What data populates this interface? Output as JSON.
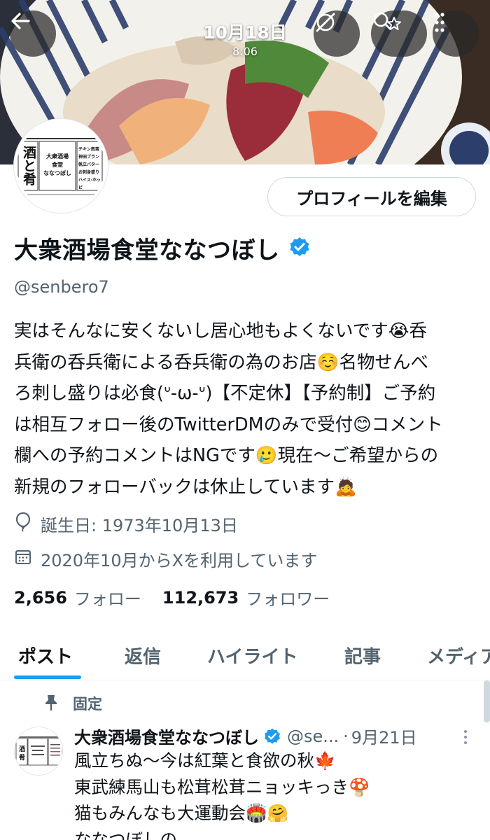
{
  "status": {
    "date": "10月18日",
    "time": "8:06"
  },
  "colors": {
    "accent": "#1d9bf0",
    "verified": "#1d9bf0",
    "text": "#0f1419",
    "muted": "#536471"
  },
  "icons": {
    "back": "arrow-left-icon",
    "grok": "slash-circle-icon",
    "search": "search-star-icon",
    "more": "vertical-dots-icon"
  },
  "avatar": {
    "left_text": "酒と肴",
    "center_text": "大衆酒場\n食堂\nななつぼし",
    "right_text": "チキン南蛮\n神田ブラン\n帆立バター\nお刺身盛り\nハイス·ホッピ"
  },
  "edit_button": "プロフィールを編集",
  "profile": {
    "name": "大衆酒場食堂ななつぼし",
    "handle": "@senbero7",
    "bio": "実はそんなに安くないし居心地もよくないです😭呑\n兵衛の呑兵衛による呑兵衛の為のお店☺️名物せんべ\nろ刺し盛りは必食(ᐡ-ω-ᐡ)【不定休】【予約制】ご予約\nは相互フォロー後のTwitterDMのみで受付😊コメント\n欄への予約コメントはNGです🥲現在〜ご希望からの\n新規のフォローバックは休止しています🙇",
    "birthday": "誕生日: 1973年10月13日",
    "joined": "2020年10月からXを利用しています",
    "following_count": "2,656",
    "following_label": "フォロー",
    "followers_count": "112,673",
    "followers_label": "フォロワー"
  },
  "tabs": [
    {
      "label": "ポスト",
      "active": true
    },
    {
      "label": "返信",
      "active": false
    },
    {
      "label": "ハイライト",
      "active": false
    },
    {
      "label": "記事",
      "active": false
    },
    {
      "label": "メディア",
      "active": false
    }
  ],
  "pinned_post": {
    "pinned_label": "固定",
    "name": "大衆酒場食堂ななつぼし",
    "handle": "@se...",
    "dot": "·",
    "date": "9月21日",
    "text": "風立ちぬ〜今は紅葉と食欲の秋🍁\n東武練馬山も松茸松茸ニョッキっき🍄\n猫もみんなも大運動会🏟️🤗\nななつぼしの"
  }
}
